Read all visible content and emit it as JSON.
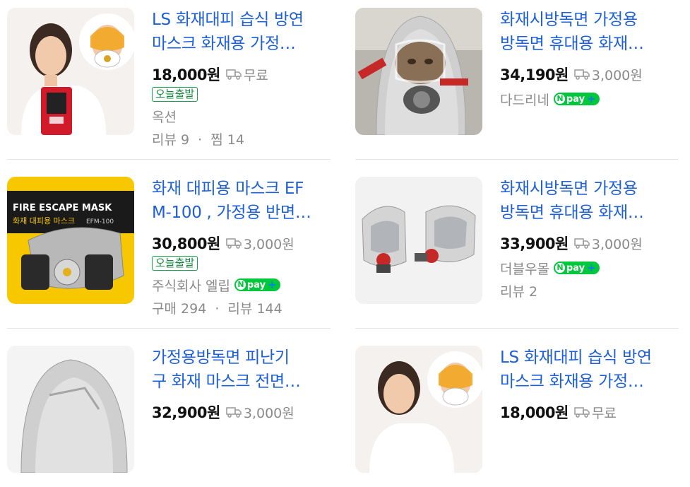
{
  "products": [
    {
      "title_line1": "LS 화재대피 습식 방연",
      "title_line2": "마스크 화재용 가정…",
      "price": "18,000원",
      "shipping": "무료",
      "badge": "오늘출발",
      "seller": "옥션",
      "npay": false,
      "stats": [
        {
          "label": "리뷰",
          "value": "9"
        },
        {
          "label": "찜",
          "value": "14"
        }
      ]
    },
    {
      "title_line1": "화재시방독면 가정용",
      "title_line2": "방독면 휴대용 화재…",
      "price": "34,190원",
      "shipping": "3,000원",
      "badge": "",
      "seller": "다드리네",
      "npay": true,
      "stats": []
    },
    {
      "title_line1": "화재 대피용 마스크 EF",
      "title_line2": "M-100 , 가정용 반면…",
      "price": "30,800원",
      "shipping": "3,000원",
      "badge": "오늘출발",
      "seller": "주식회사 엘립",
      "npay": true,
      "stats": [
        {
          "label": "구매",
          "value": "294"
        },
        {
          "label": "리뷰",
          "value": "144"
        }
      ]
    },
    {
      "title_line1": "화재시방독면 가정용",
      "title_line2": "방독면 휴대용 화재…",
      "price": "33,900원",
      "shipping": "3,000원",
      "badge": "",
      "seller": "더블우몰",
      "npay": true,
      "stats": [
        {
          "label": "리뷰",
          "value": "2"
        }
      ]
    },
    {
      "title_line1": "가정용방독면 피난기",
      "title_line2": "구 화재 마스크 전면…",
      "price": "32,900원",
      "shipping": "3,000원",
      "badge": "",
      "seller": "",
      "npay": false,
      "stats": []
    },
    {
      "title_line1": "LS 화재대피 습식 방연",
      "title_line2": "마스크 화재용 가정…",
      "price": "18,000원",
      "shipping": "무료",
      "badge": "",
      "seller": "",
      "npay": false,
      "stats": []
    }
  ],
  "npay_label": "pay",
  "npay_n": "N",
  "npay_plus": "+",
  "image_texts": {
    "fire_escape_mask": "FIRE ESCAPE MASK",
    "fire_escape_mask_kr": "화재 대피용 마스크",
    "model": "EFM-100"
  },
  "colors": {
    "title": "#1c5fd8",
    "badge": "#17a34a",
    "npay": "#00c73c",
    "muted": "#8a8a8a"
  }
}
